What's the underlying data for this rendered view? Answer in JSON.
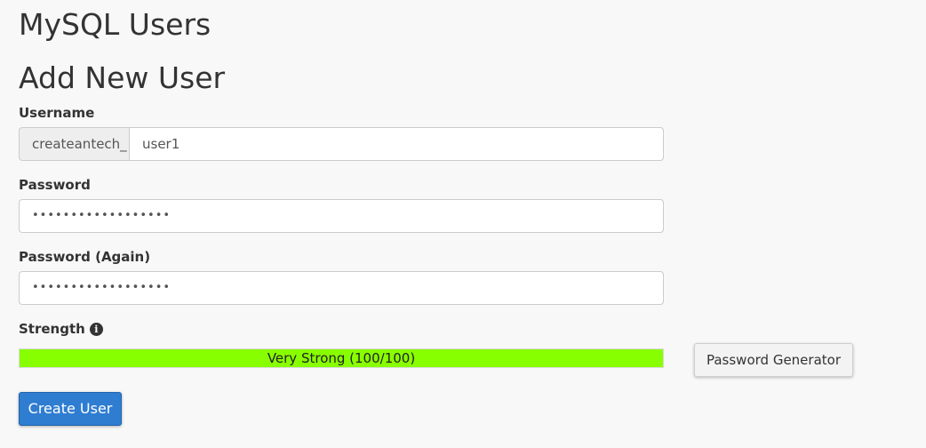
{
  "page": {
    "title": "MySQL Users",
    "section_title": "Add New User"
  },
  "form": {
    "username_label": "Username",
    "username_prefix": "createantech_",
    "username_value": "user1",
    "password_label": "Password",
    "password_value": "••••••••••••••••••",
    "password_again_label": "Password (Again)",
    "password_again_value": "••••••••••••••••••",
    "strength_label": "Strength",
    "strength_info_icon": "info-circle-icon",
    "strength_text": "Very Strong (100/100)",
    "strength_level": 100,
    "strength_color": "#88ff00",
    "generator_button": "Password Generator",
    "submit_button": "Create User"
  },
  "colors": {
    "primary_button": "#2f7dd1",
    "background": "#f8f8f8"
  }
}
